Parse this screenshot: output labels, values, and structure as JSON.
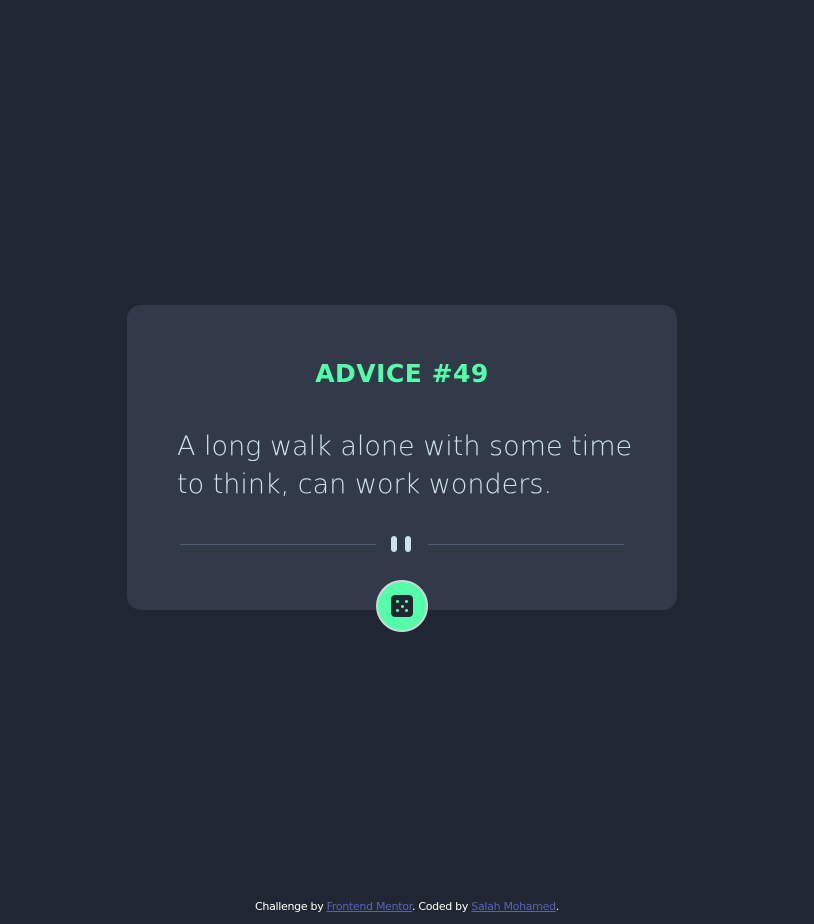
{
  "card": {
    "title": "ADVICE #49",
    "quote": "A long walk alone with some time to think, can work wonders."
  },
  "divider": {
    "icon": "pause-icon"
  },
  "dice_button": {
    "icon": "dice-icon"
  },
  "footer": {
    "prefix": "Challenge by ",
    "challenge_link": "Frontend Mentor",
    "middle": ". Coded by ",
    "author_link": "Salah Mohamed",
    "suffix": "."
  },
  "colors": {
    "background": "#202632",
    "card": "#323a49",
    "accent": "#53ffaa",
    "text": "#cee3e9",
    "link": "#5a63b0"
  }
}
